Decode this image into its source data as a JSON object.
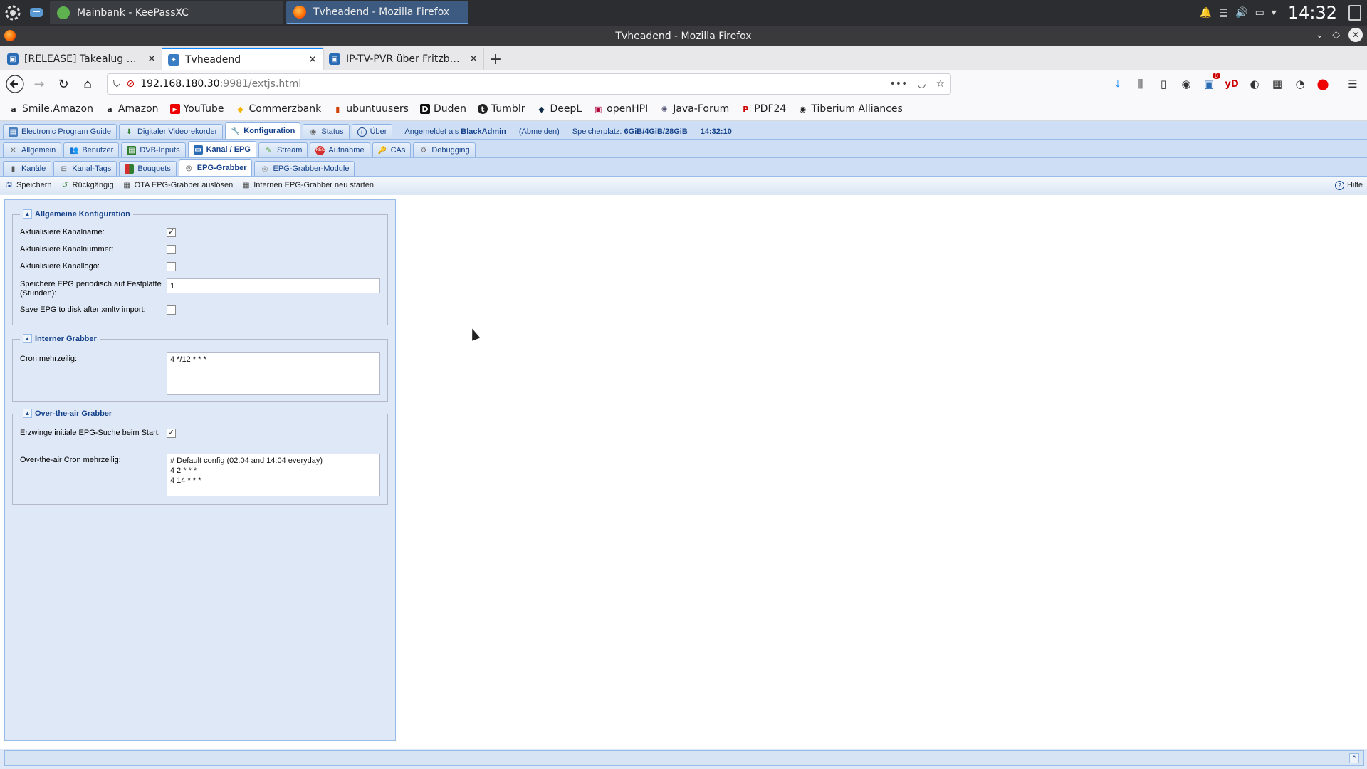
{
  "taskbar": {
    "tasks": [
      {
        "label": "Mainbank - KeePassXC"
      },
      {
        "label": "Tvheadend - Mozilla Firefox"
      }
    ],
    "clock": "14:32"
  },
  "window": {
    "title": "Tvheadend - Mozilla Firefox"
  },
  "browser": {
    "tabs": [
      {
        "label": "[RELEASE] Takealug EPG Grabber"
      },
      {
        "label": "Tvheadend"
      },
      {
        "label": "IP-TV-PVR über Fritzbox ge"
      }
    ],
    "url_host": "192.168.180.30",
    "url_path": ":9981/extjs.html",
    "bookmarks": [
      {
        "label": "Smile.Amazon",
        "icon": "a"
      },
      {
        "label": "Amazon",
        "icon": "a"
      },
      {
        "label": "YouTube",
        "icon": "▶"
      },
      {
        "label": "Commerzbank",
        "icon": "◆"
      },
      {
        "label": "ubuntuusers",
        "icon": "▮"
      },
      {
        "label": "Duden",
        "icon": "D"
      },
      {
        "label": "Tumblr",
        "icon": "t"
      },
      {
        "label": "DeepL",
        "icon": "◆"
      },
      {
        "label": "openHPI",
        "icon": "▣"
      },
      {
        "label": "Java-Forum",
        "icon": "✺"
      },
      {
        "label": "PDF24",
        "icon": "P"
      },
      {
        "label": "Tiberium Alliances",
        "icon": "◉"
      }
    ],
    "downloads_badge": "0"
  },
  "app": {
    "main_tabs": [
      {
        "label": "Electronic Program Guide"
      },
      {
        "label": "Digitaler Videorekorder"
      },
      {
        "label": "Konfiguration"
      },
      {
        "label": "Status"
      },
      {
        "label": "Über"
      }
    ],
    "login_prefix": "Angemeldet als",
    "login_user": "BlackAdmin",
    "logout": "(Abmelden)",
    "storage_prefix": "Speicherplatz:",
    "storage_value": "6GiB/4GiB/28GiB",
    "time": "14:32:10",
    "config_tabs": [
      {
        "label": "Allgemein"
      },
      {
        "label": "Benutzer"
      },
      {
        "label": "DVB-Inputs"
      },
      {
        "label": "Kanal / EPG"
      },
      {
        "label": "Stream"
      },
      {
        "label": "Aufnahme"
      },
      {
        "label": "CAs"
      },
      {
        "label": "Debugging"
      }
    ],
    "channel_tabs": [
      {
        "label": "Kanäle"
      },
      {
        "label": "Kanal-Tags"
      },
      {
        "label": "Bouquets"
      },
      {
        "label": "EPG-Grabber"
      },
      {
        "label": "EPG-Grabber-Module"
      }
    ],
    "toolbar": {
      "save": "Speichern",
      "undo": "Rückgängig",
      "trigger_ota": "OTA EPG-Grabber auslösen",
      "restart_internal": "Internen EPG-Grabber neu starten",
      "help": "Hilfe"
    },
    "general": {
      "legend": "Allgemeine Konfiguration",
      "update_name_label": "Aktualisiere Kanalname:",
      "update_number_label": "Aktualisiere Kanalnummer:",
      "update_logo_label": "Aktualisiere Kanallogo:",
      "save_periodic_label": "Speichere EPG periodisch auf Festplatte (Stunden):",
      "save_periodic_value": "1",
      "save_xmltv_label": "Save EPG to disk after xmltv import:",
      "update_name_checked": "✓",
      "update_number_checked": "",
      "update_logo_checked": "",
      "save_xmltv_checked": ""
    },
    "internal": {
      "legend": "Interner Grabber",
      "cron_label": "Cron mehrzeilig:",
      "cron_value": "4 */12 * * *"
    },
    "ota": {
      "legend": "Over-the-air Grabber",
      "force_label": "Erzwinge initiale EPG-Suche beim Start:",
      "force_checked": "✓",
      "cron_label": "Over-the-air Cron mehrzeilig:",
      "cron_value": "# Default config (02:04 and 14:04 everyday)\n4 2 * * *\n4 14 * * *"
    }
  }
}
